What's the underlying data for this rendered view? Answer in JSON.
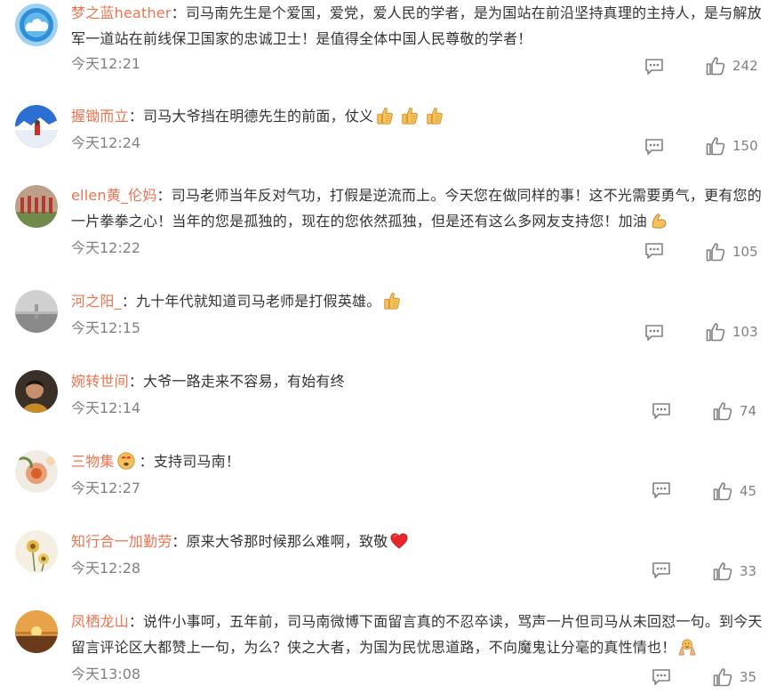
{
  "colors": {
    "username": "#eb7350",
    "text": "#333333",
    "meta": "#808080"
  },
  "comments": [
    {
      "user": "梦之蓝heather",
      "sep": "：",
      "text": "司马南先生是个爱国，爱党，爱人民的学者，是为国站在前沿坚持真理的主持人，是与解放军一道站在前线保卫国家的忠诚卫士！是值得全体中国人民尊敬的学者！",
      "time": "今天12:21",
      "likes": "242",
      "avatar_icon": "cloud-avatar-icon"
    },
    {
      "user": "握锄而立",
      "sep": "：",
      "text": "司马大爷挡在明德先生的前面，仗义",
      "emojis": [
        "thumbs-up-emoji",
        "thumbs-up-emoji",
        "thumbs-up-emoji"
      ],
      "time": "今天12:24",
      "likes": "150",
      "avatar_icon": "mountain-avatar-icon"
    },
    {
      "user": "ellen黄_伦妈",
      "sep": "：",
      "text": "司马老师当年反对气功，打假是逆流而上。今天您在做同样的事！这不光需要勇气，更有您的一片拳拳之心！当年的您是孤独的，现在的您依然孤独，但是还有这么多网友支持您！加油",
      "emojis": [
        "flexed-biceps-emoji"
      ],
      "time": "今天12:22",
      "likes": "105",
      "avatar_icon": "cemetery-avatar-icon"
    },
    {
      "user": "河之阳_",
      "sep": "：",
      "text": "九十年代就知道司马老师是打假英雄。",
      "emojis": [
        "thumbs-up-emoji"
      ],
      "time": "今天12:15",
      "likes": "103",
      "avatar_icon": "gray-landscape-avatar-icon"
    },
    {
      "user": "婉转世间",
      "sep": "：",
      "text": "大爷一路走来不容易，有始有终",
      "time": "今天12:14",
      "likes": "74",
      "avatar_icon": "dark-portrait-avatar-icon"
    },
    {
      "user": "三物集",
      "badge_icon": "emoji-badge-icon",
      "sep": "：",
      "text": "支持司马南！",
      "time": "今天12:27",
      "likes": "45",
      "avatar_icon": "flower-avatar-icon"
    },
    {
      "user": "知行合一加勤劳",
      "sep": "：",
      "text": "原来大爷那时候那么难啊，致敬",
      "emojis": [
        "red-heart-emoji"
      ],
      "time": "今天12:28",
      "likes": "33",
      "avatar_icon": "flower-sketch-avatar-icon"
    },
    {
      "user": "凤栖龙山",
      "sep": "：",
      "text": "说件小事呵，五年前，司马南微博下面留言真的不忍卒读，骂声一片但司马从未回怼一句。到今天留言评论区大都赞上一句，为么？侠之大者，为国为民忧思道路，不向魔鬼让分毫的真性情也！",
      "emojis": [
        "folded-hands-emoji"
      ],
      "time": "今天13:08",
      "likes": "35",
      "avatar_icon": "sunset-avatar-icon"
    }
  ]
}
